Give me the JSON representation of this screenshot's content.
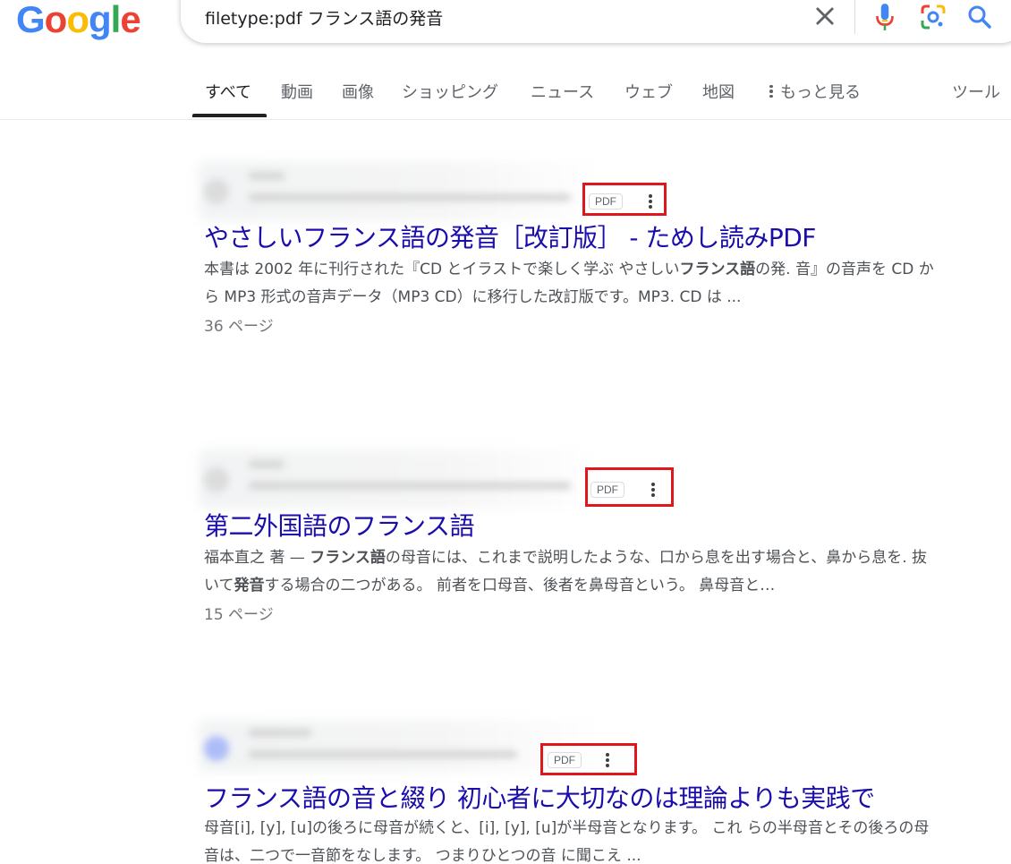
{
  "logo": {
    "letters": [
      "G",
      "o",
      "o",
      "g",
      "l",
      "e"
    ],
    "colors": [
      "#4285F4",
      "#EA4335",
      "#FBBC05",
      "#4285F4",
      "#34A853",
      "#EA4335"
    ]
  },
  "search": {
    "query": "filetype:pdf フランス語の発音"
  },
  "icons": {
    "clear": "close-icon",
    "mic": "microphone-icon",
    "lens": "google-lens-icon",
    "search": "search-icon"
  },
  "tabs": [
    {
      "label": "すべて",
      "active": true
    },
    {
      "label": "動画"
    },
    {
      "label": "画像"
    },
    {
      "label": "ショッピング"
    },
    {
      "label": "ニュース"
    },
    {
      "label": "ウェブ"
    },
    {
      "label": "地図"
    },
    {
      "label": "もっと見る"
    },
    {
      "label": "ツール"
    }
  ],
  "results": [
    {
      "badge": "PDF",
      "title": "やさしいフランス語の発音［改訂版］ - ためし読みPDF",
      "snippet_html_parts": [
        "本書は 2002 年に刊行された『CD とイラストで楽しく学ぶ やさしい",
        "フランス語",
        "の発. 音』の音声を CD から MP3 形式の音声データ（MP3 CD）に移行した改訂版です。MP3. CD は ..."
      ],
      "pages": "36 ページ"
    },
    {
      "badge": "PDF",
      "title": "第二外国語のフランス語",
      "snippet_html_parts": [
        "福本直之 著 — ",
        "フランス語",
        "の母音には、これまで説明したような、口から息を出す場合と、鼻から息を. 抜いて",
        "発音",
        "する場合の二つがある。 前者を口母音、後者を鼻母音という。 鼻母音と…"
      ],
      "pages": "15 ページ"
    },
    {
      "badge": "PDF",
      "title": "フランス語の音と綴り 初心者に大切なのは理論よりも実践で",
      "snippet_html_parts": [
        "母音[i], [y], [u]の後ろに母音が続くと、[i], [y], [u]が半母音となります。 これ らの半母音とその後ろの母音は、二つで一音節をなします。 つまりひとつの音 に聞こえ ..."
      ]
    }
  ]
}
